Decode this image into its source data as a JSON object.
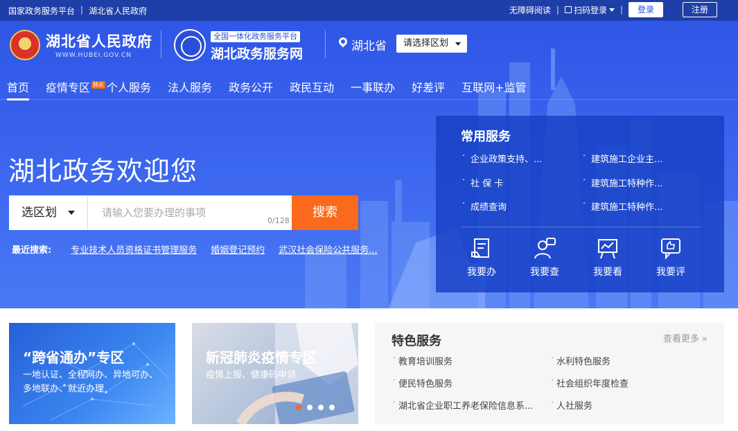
{
  "topbar": {
    "platform_link": "国家政务服务平台",
    "gov_link": "湖北省人民政府",
    "accessible": "无障碍阅读",
    "qr_login": "扫码登录",
    "login": "登录",
    "register": "注册"
  },
  "header": {
    "gov_title": "湖北省人民政府",
    "gov_url": "WWW.HUBEI.GOV.CN",
    "svc_tag": "全国一体化政务服务平台",
    "svc_name": "湖北政务服务网",
    "location": "湖北省",
    "region_select": "请选择区划"
  },
  "nav": {
    "items": [
      "首页",
      "疫情专区",
      "个人服务",
      "法人服务",
      "政务公开",
      "政民互动",
      "一事联办",
      "好差评",
      "互联网+监管"
    ],
    "badge": "肺炎"
  },
  "hero": {
    "welcome": "湖北政务欢迎您",
    "search_region": "选区划",
    "search_placeholder": "请输入您要办理的事项",
    "search_count": "0/128",
    "search_button": "搜索",
    "recent_label": "最近搜索:",
    "recent": [
      "专业技术人员资格证书管理服务",
      "婚姻登记预约",
      "武汉社会保险公共服务..."
    ]
  },
  "common": {
    "title": "常用服务",
    "items": [
      "企业政策支持、...",
      "建筑施工企业主...",
      "社 保 卡",
      "建筑施工特种作...",
      "成绩查询",
      "建筑施工特种作..."
    ],
    "actions": [
      "我要办",
      "我要查",
      "我要看",
      "我要评"
    ]
  },
  "cards": {
    "c1_title": "“跨省通办”专区",
    "c1_sub": "一地认证、全程网办、异地可办、多地联办、就近办理",
    "c2_title": "新冠肺炎疫情专区",
    "c2_sub": "疫情上报、健康码申领"
  },
  "feature": {
    "title": "特色服务",
    "more": "查看更多 »",
    "items": [
      "教育培训服务",
      "水利特色服务",
      "便民特色服务",
      "社会组织年度检查",
      "湖北省企业职工养老保险信息系...",
      "人社服务"
    ]
  },
  "colors": {
    "primary": "#2f56e6",
    "accent": "#fb6a1c",
    "panel": "#1640c4"
  }
}
